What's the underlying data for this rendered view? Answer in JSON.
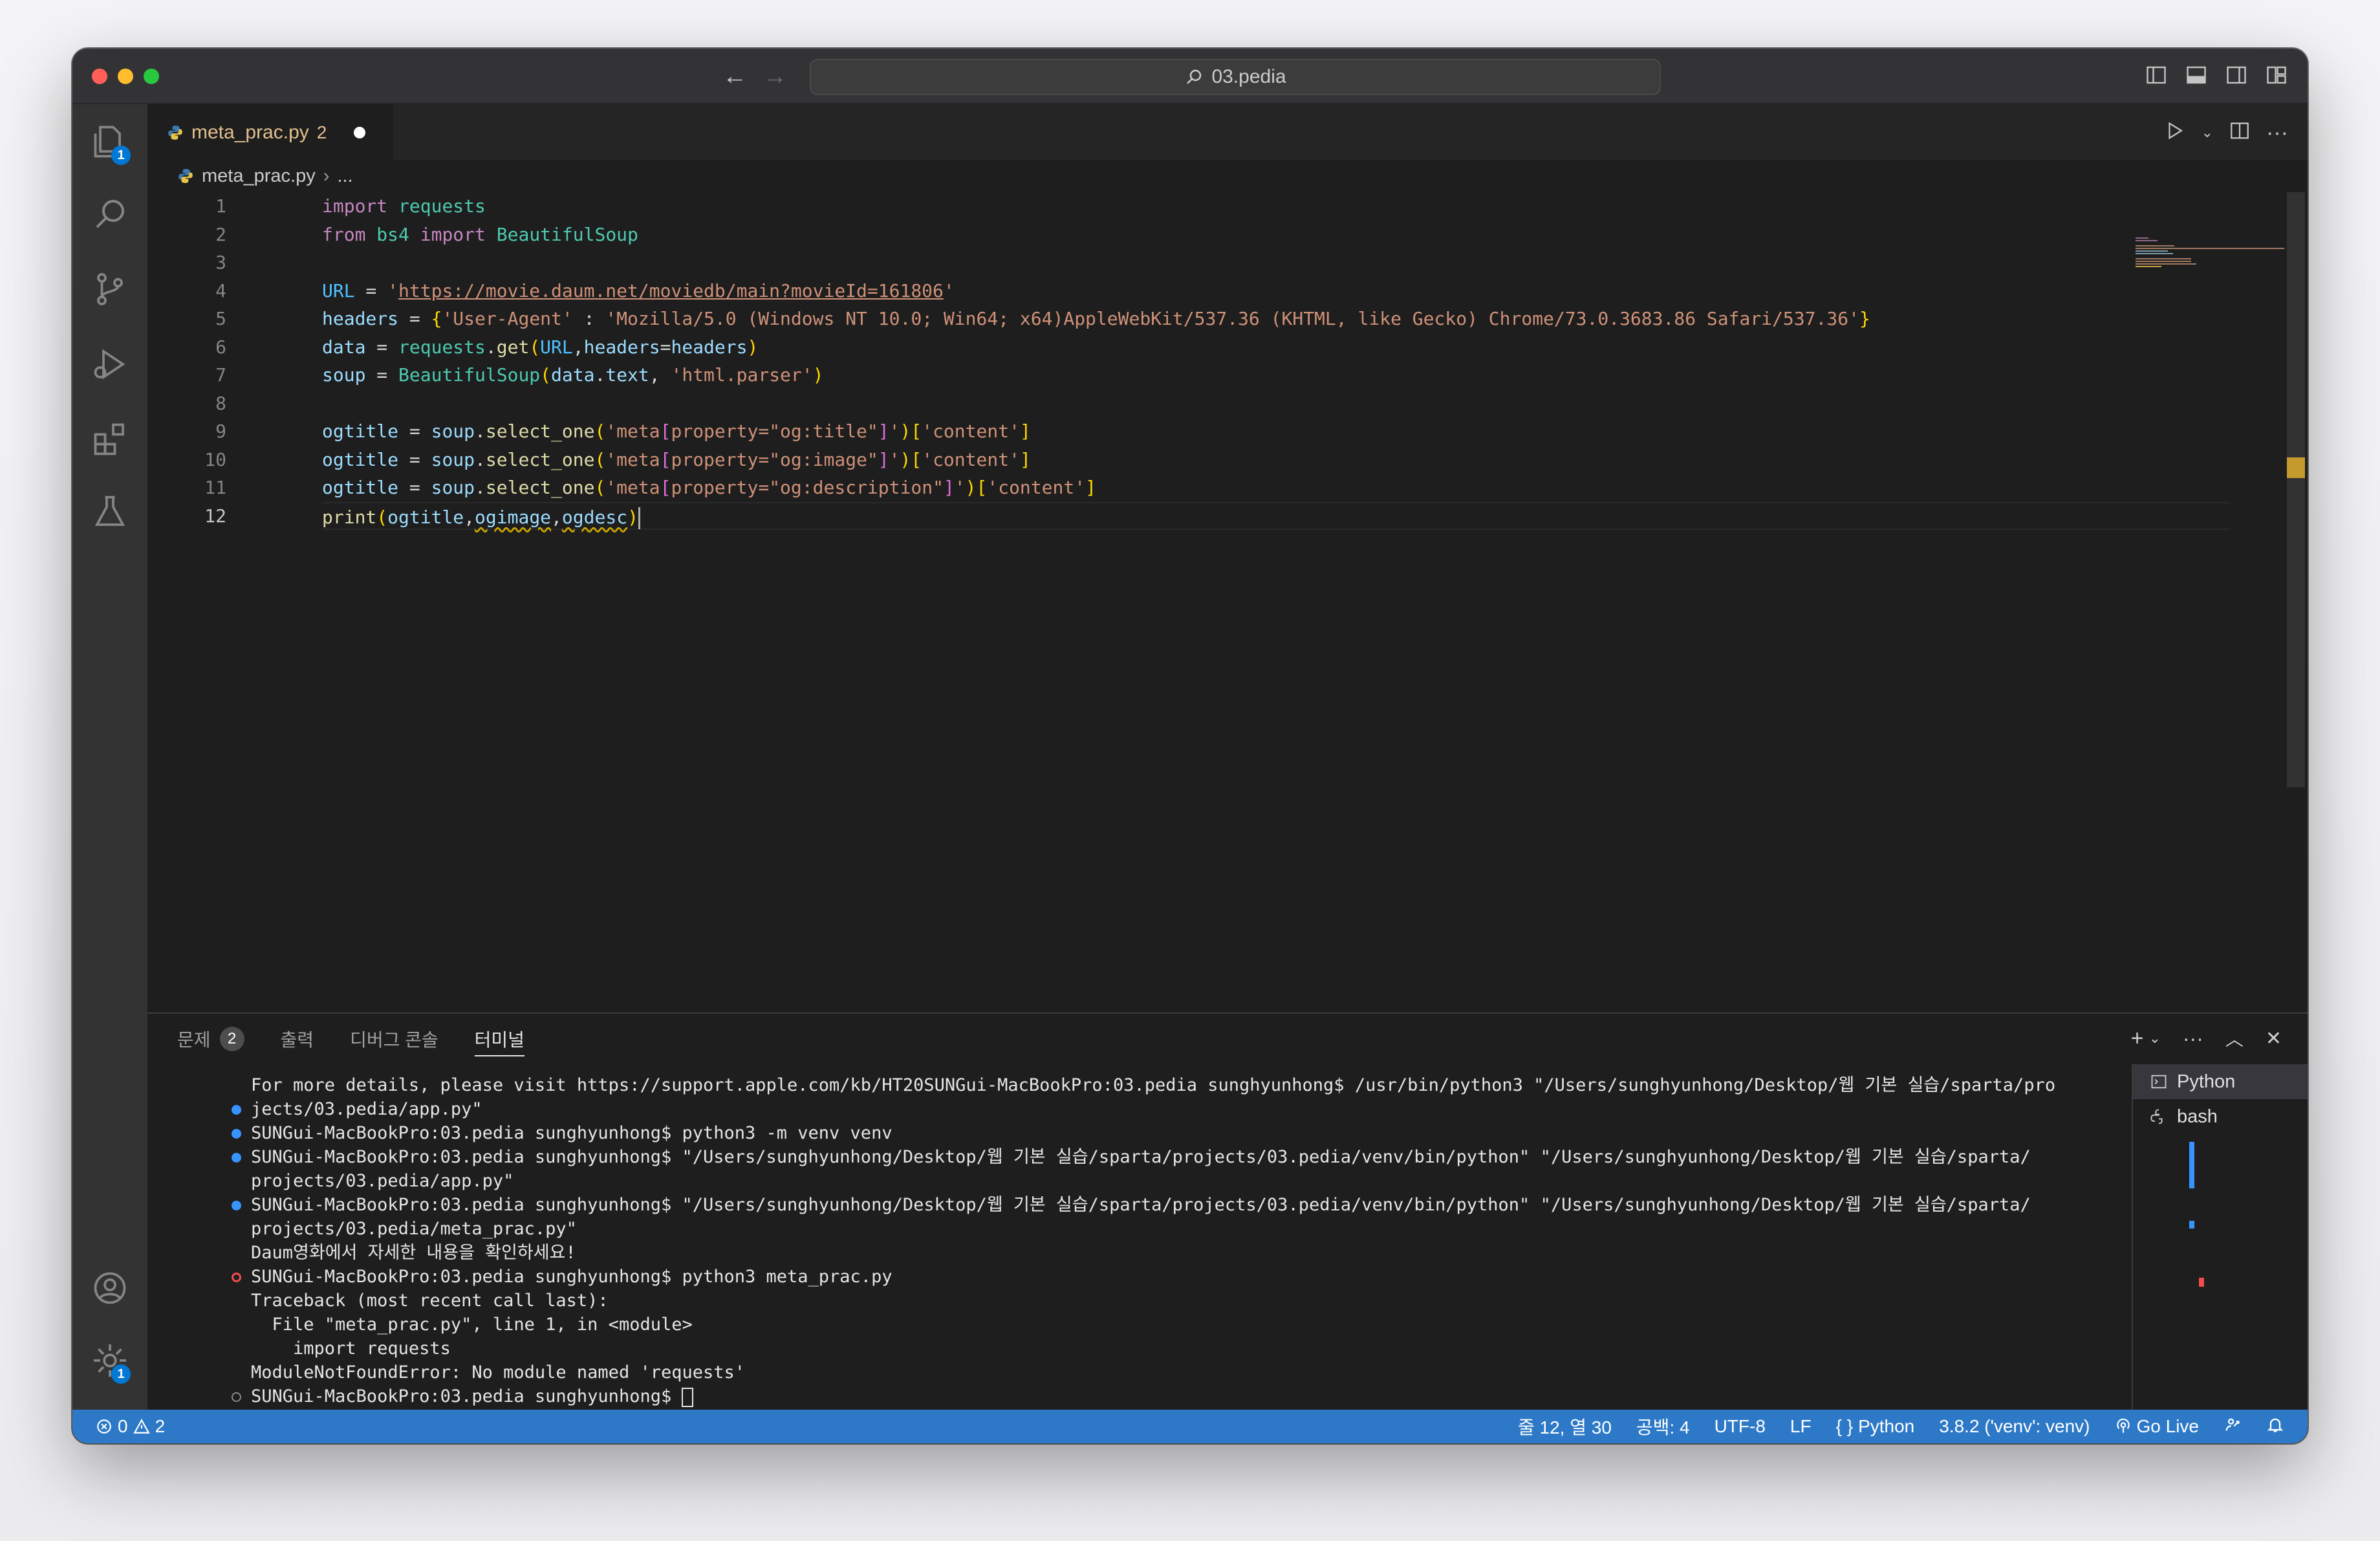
{
  "window": {
    "search_title": "03.pedia"
  },
  "activity_bar": {
    "explorer_badge": "1",
    "settings_badge": "1"
  },
  "editor_tab": {
    "filename": "meta_prac.py",
    "problem_count": "2"
  },
  "breadcrumb": {
    "file": "meta_prac.py",
    "more": "..."
  },
  "editor": {
    "line_numbers": [
      "1",
      "2",
      "3",
      "4",
      "5",
      "6",
      "7",
      "8",
      "9",
      "10",
      "11",
      "12"
    ],
    "lines": [
      "import requests",
      "from bs4 import BeautifulSoup",
      "",
      "URL = 'https://movie.daum.net/moviedb/main?movieId=161806'",
      "headers = {'User-Agent' : 'Mozilla/5.0 (Windows NT 10.0; Win64; x64)AppleWebKit/537.36 (KHTML, like Gecko) Chrome/73.0.3683.86 Safari/537.36'}",
      "data = requests.get(URL,headers=headers)",
      "soup = BeautifulSoup(data.text, 'html.parser')",
      "",
      "ogtitle = soup.select_one('meta[property=\"og:title\"]')['content']",
      "ogtitle = soup.select_one('meta[property=\"og:image\"]')['content']",
      "ogtitle = soup.select_one('meta[property=\"og:description\"]')['content']",
      "print(ogtitle,ogimage,ogdesc)"
    ],
    "current_line": 12
  },
  "panel": {
    "tabs": [
      {
        "label": "문제",
        "count": "2"
      },
      {
        "label": "출력"
      },
      {
        "label": "디버그 콘솔"
      },
      {
        "label": "터미널",
        "active": true
      }
    ],
    "terminal_lines": [
      {
        "marker": "",
        "text": "For more details, please visit https://support.apple.com/kb/HT20SUNGui-MacBookPro:03.pedia sunghyunhong$ /usr/bin/python3 \"/Users/sunghyunhong/Desktop/웹 기본 실습/sparta/pro"
      },
      {
        "marker": "blue",
        "text": "jects/03.pedia/app.py\""
      },
      {
        "marker": "blue",
        "text": "SUNGui-MacBookPro:03.pedia sunghyunhong$ python3 -m venv venv"
      },
      {
        "marker": "blue",
        "text": "SUNGui-MacBookPro:03.pedia sunghyunhong$ \"/Users/sunghyunhong/Desktop/웹 기본 실습/sparta/projects/03.pedia/venv/bin/python\" \"/Users/sunghyunhong/Desktop/웹 기본 실습/sparta/"
      },
      {
        "marker": "",
        "text": "projects/03.pedia/app.py\""
      },
      {
        "marker": "blue",
        "text": "SUNGui-MacBookPro:03.pedia sunghyunhong$ \"/Users/sunghyunhong/Desktop/웹 기본 실습/sparta/projects/03.pedia/venv/bin/python\" \"/Users/sunghyunhong/Desktop/웹 기본 실습/sparta/"
      },
      {
        "marker": "",
        "text": "projects/03.pedia/meta_prac.py\""
      },
      {
        "marker": "",
        "text": "Daum영화에서 자세한 내용을 확인하세요!"
      },
      {
        "marker": "err",
        "text": "SUNGui-MacBookPro:03.pedia sunghyunhong$ python3 meta_prac.py"
      },
      {
        "marker": "",
        "text": "Traceback (most recent call last):"
      },
      {
        "marker": "",
        "text": "  File \"meta_prac.py\", line 1, in <module>"
      },
      {
        "marker": "",
        "text": "    import requests"
      },
      {
        "marker": "",
        "text": "ModuleNotFoundError: No module named 'requests'"
      },
      {
        "marker": "empty",
        "text": "SUNGui-MacBookPro:03.pedia sunghyunhong$ "
      }
    ],
    "terminals": [
      {
        "name": "Python",
        "active": true
      },
      {
        "name": "bash"
      }
    ]
  },
  "status_bar": {
    "errors": "0",
    "warnings": "2",
    "position": "줄 12, 열 30",
    "indent": "공백: 4",
    "encoding": "UTF-8",
    "eol": "LF",
    "language": "Python",
    "interpreter": "3.8.2 ('venv': venv)",
    "go_live": "Go Live"
  },
  "colors": {
    "accent": "#2d79c7",
    "modified_tab": "#e2c08d",
    "error": "#f14c4c"
  }
}
